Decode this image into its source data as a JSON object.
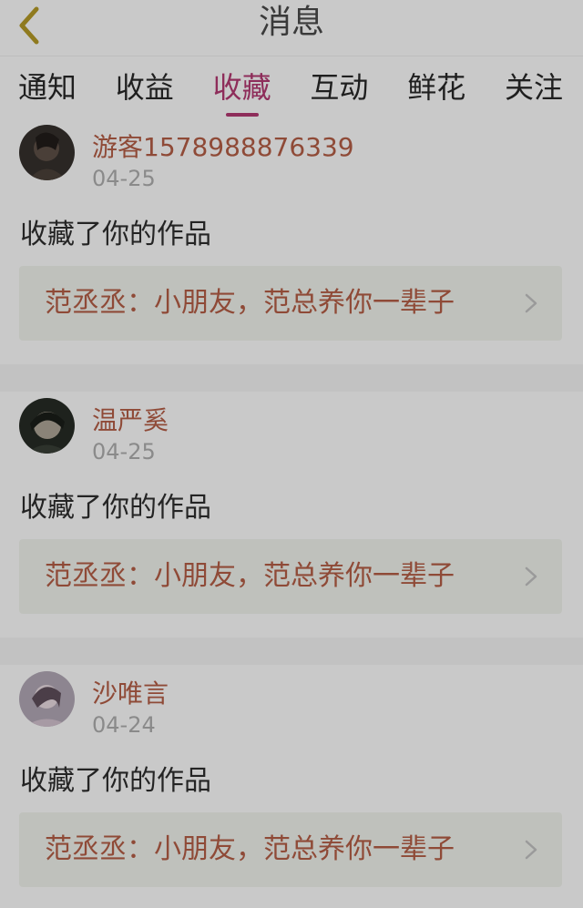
{
  "header": {
    "title": "消息",
    "back_icon": "chevron-left-icon",
    "accent_color": "#8f7a1e"
  },
  "tabs": [
    {
      "label": "通知",
      "active": false
    },
    {
      "label": "收益",
      "active": false
    },
    {
      "label": "收藏",
      "active": true
    },
    {
      "label": "互动",
      "active": false
    },
    {
      "label": "鲜花",
      "active": false
    },
    {
      "label": "关注",
      "active": false
    }
  ],
  "colors": {
    "active_tab": "#8e2d5a",
    "name": "#8f4a37",
    "work_box_bg": "#bfc1bc"
  },
  "messages": [
    {
      "name": "游客1578988876339",
      "date": "04-25",
      "action": "收藏了你的作品",
      "work_title": "范丞丞：小朋友，范总养你一辈子",
      "chevron_icon": "chevron-right-icon"
    },
    {
      "name": "温严奚",
      "date": "04-25",
      "action": "收藏了你的作品",
      "work_title": "范丞丞：小朋友，范总养你一辈子",
      "chevron_icon": "chevron-right-icon"
    },
    {
      "name": "沙唯言",
      "date": "04-24",
      "action": "收藏了你的作品",
      "work_title": "范丞丞：小朋友，范总养你一辈子",
      "chevron_icon": "chevron-right-icon"
    }
  ]
}
